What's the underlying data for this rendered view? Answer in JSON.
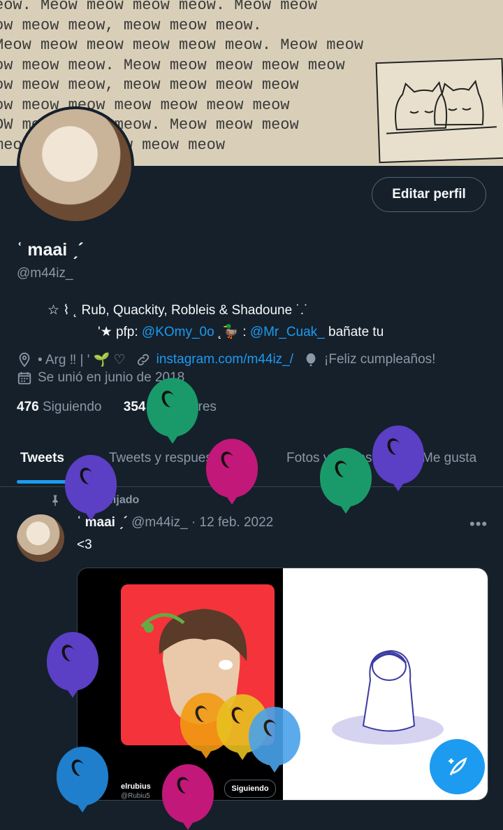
{
  "banner": {
    "lines": [
      "eow. Meow meow meow meow. Meow meow",
      "ow meow meow, meow meow meow.",
      "   Meow meow meow meow meow meow. Meow meow",
      "ow meow meow. Meow meow meow meow meow",
      "ow meow meow, meow meow meow meow",
      "ow meow meow meow meow meow meow",
      "OW meow meow meow. Meow meow meow",
      "   meow. Meow meow meow meow"
    ]
  },
  "profile": {
    "edit_button": "Editar perfil",
    "name": "ʿ maai ˏ´",
    "handle": "@m44iz_",
    "bio_line1": "☆ ⌇ ˛ Rub, Quackity, Robleis & Shadoune ˙.˙",
    "bio_line2_prefix": "'★ pfp: ",
    "bio_link1": "@KOmy_0o",
    "bio_line2_mid": "    ˛🦆 : ",
    "bio_link2": "@Mr_Cuak_",
    "bio_line2_suffix": " bañate tu",
    "location": "• Arg ‼ | ' 🌱 ♡",
    "website": "instagram.com/m44iz_/",
    "birthday": "¡Feliz cumpleaños!",
    "joined": "Se unió en junio de 2018",
    "following_count": "476",
    "following_label": "Siguiendo",
    "followers_count": "354",
    "followers_label": "Seguidores"
  },
  "tabs": [
    "Tweets",
    "Tweets y respuestas",
    "Fotos y videos",
    "Me gusta"
  ],
  "tweet": {
    "pinned_label": "Tweet fijado",
    "name": "ʿ maai ˏ´",
    "meta": "@m44iz_ · 12 feb. 2022",
    "more": "•••",
    "text": "<3",
    "media": {
      "embedded_name": "elrubius",
      "embedded_handle": "@Rubiu5",
      "embedded_button": "Siguiendo"
    }
  },
  "colors": {
    "background": "#15202b",
    "accent": "#1d9bf0",
    "muted": "#8b98a5",
    "balloon_green": "#1a9a6a",
    "balloon_purple": "#5b3fc4",
    "balloon_magenta": "#c2187a",
    "balloon_orange": "#f29b13",
    "balloon_yellow": "#e8c021",
    "balloon_lightblue": "#4aa3ea",
    "balloon_blue": "#1f7fcc"
  },
  "icons": {
    "location": "location-pin-icon",
    "link": "link-icon",
    "birthday": "balloon-icon",
    "calendar": "calendar-icon",
    "pin": "pin-icon",
    "compose": "compose-feather-icon"
  }
}
